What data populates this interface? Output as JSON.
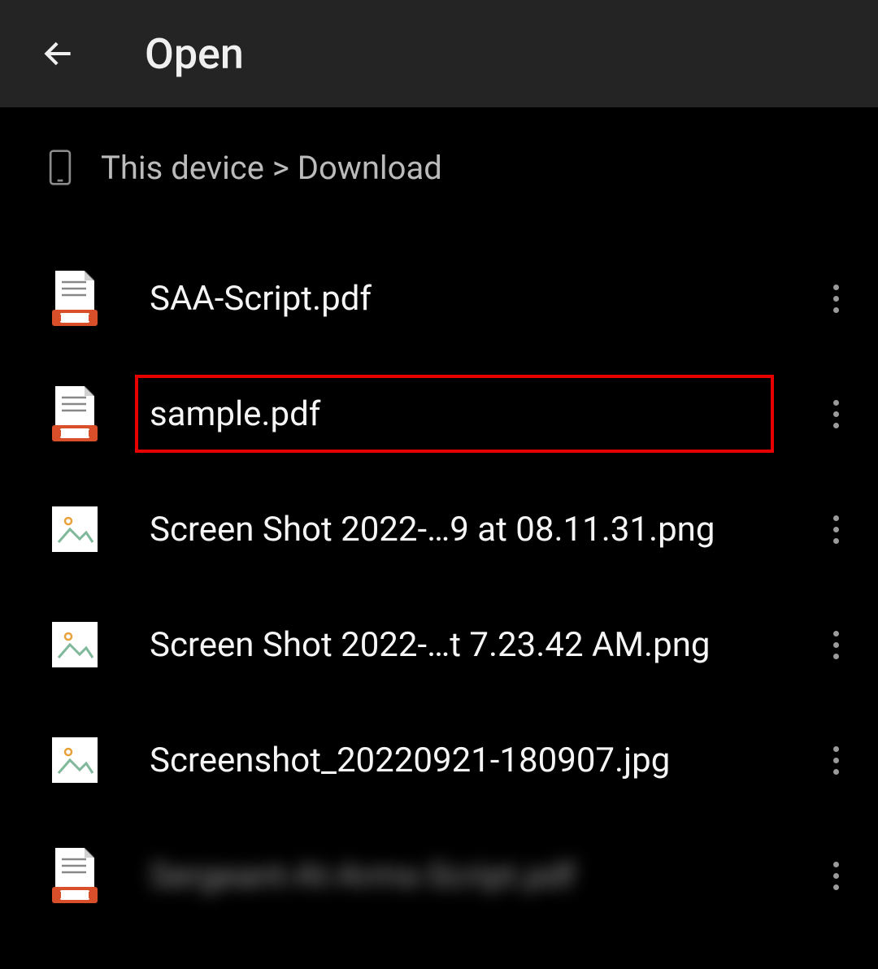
{
  "header": {
    "title": "Open"
  },
  "breadcrumb": {
    "text": "This device > Download"
  },
  "files": [
    {
      "name": "SAA-Script.pdf",
      "type": "pdf",
      "highlighted": false,
      "blurred": false
    },
    {
      "name": "sample.pdf",
      "type": "pdf",
      "highlighted": true,
      "blurred": false
    },
    {
      "name": "Screen Shot 2022-…9 at 08.11.31.png",
      "type": "image",
      "highlighted": false,
      "blurred": false
    },
    {
      "name": "Screen Shot 2022-…t 7.23.42 AM.png",
      "type": "image",
      "highlighted": false,
      "blurred": false
    },
    {
      "name": "Screenshot_20220921-180907.jpg",
      "type": "image",
      "highlighted": false,
      "blurred": false
    },
    {
      "name": "Sergeant-At-Arms-Script.pdf",
      "type": "pdf",
      "highlighted": false,
      "blurred": true
    }
  ]
}
